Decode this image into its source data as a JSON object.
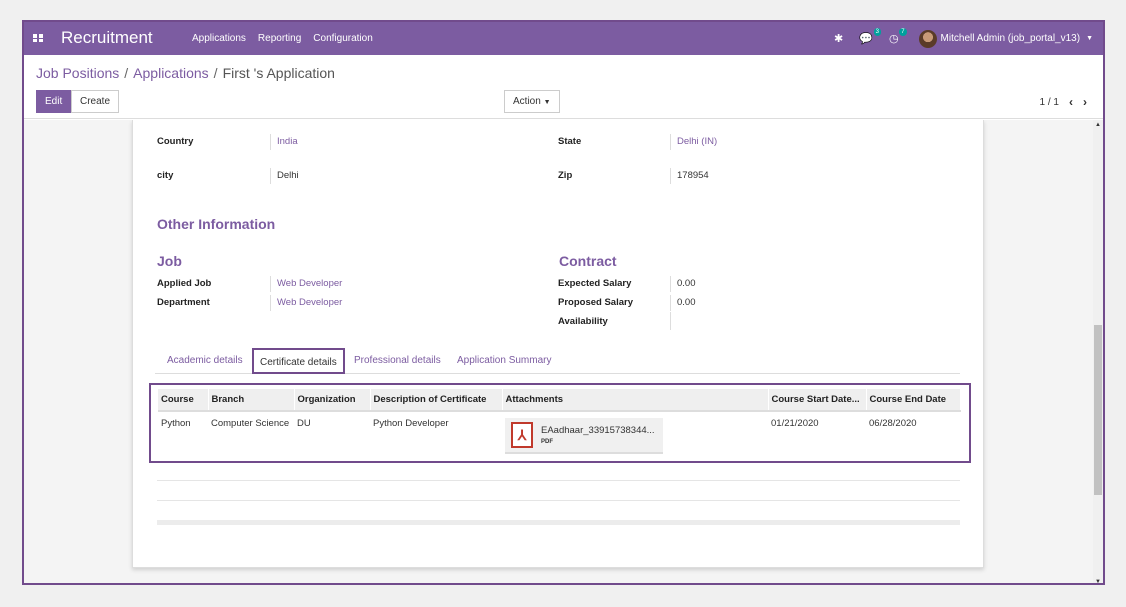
{
  "navbar": {
    "app_title": "Recruitment",
    "menu": [
      "Applications",
      "Reporting",
      "Configuration"
    ],
    "messages_count": "3",
    "activities_count": "7",
    "user": "Mitchell Admin (job_portal_v13)"
  },
  "breadcrumb": {
    "items": [
      "Job Positions",
      "Applications"
    ],
    "current": "First 's Application"
  },
  "buttons": {
    "edit": "Edit",
    "create": "Create",
    "action": "Action"
  },
  "pager": {
    "value": "1 / 1"
  },
  "address": {
    "country_label": "Country",
    "country_value": "India",
    "state_label": "State",
    "state_value": "Delhi (IN)",
    "city_label": "city",
    "city_value": "Delhi",
    "zip_label": "Zip",
    "zip_value": "178954"
  },
  "other_info": {
    "title": "Other Information",
    "job_title": "Job",
    "applied_job_label": "Applied Job",
    "applied_job_value": "Web Developer",
    "department_label": "Department",
    "department_value": "Web Developer",
    "contract_title": "Contract",
    "expected_salary_label": "Expected Salary",
    "expected_salary_value": "0.00",
    "proposed_salary_label": "Proposed Salary",
    "proposed_salary_value": "0.00",
    "availability_label": "Availability",
    "availability_value": ""
  },
  "tabs": [
    "Academic details",
    "Certificate details",
    "Professional details",
    "Application Summary"
  ],
  "certificate_table": {
    "headers": [
      "Course",
      "Branch",
      "Organization",
      "Description of Certificate",
      "Attachments",
      "Course Start Date...",
      "Course End Date"
    ],
    "rows": [
      {
        "course": "Python",
        "branch": "Computer Science",
        "organization": "DU",
        "description": "Python Developer",
        "attachment_name": "EAadhaar_33915738344...",
        "attachment_type": "PDF",
        "start_date": "01/21/2020",
        "end_date": "06/28/2020"
      }
    ]
  },
  "colors": {
    "brand": "#7c5ca1",
    "highlight_border": "#714b8c",
    "pdf_red": "#c0392b"
  }
}
